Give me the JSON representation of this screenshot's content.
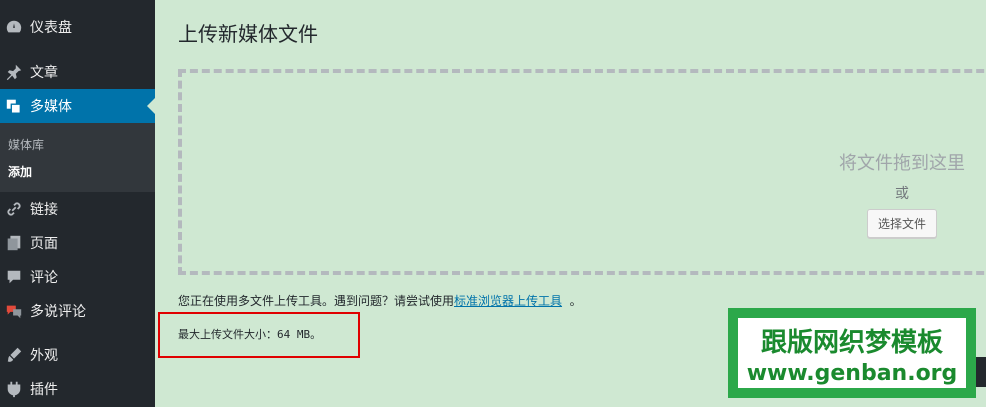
{
  "sidebar": {
    "items": [
      {
        "label": "仪表盘",
        "icon": "dashboard-icon"
      },
      {
        "label": "文章",
        "icon": "pin-icon"
      },
      {
        "label": "多媒体",
        "icon": "media-icon"
      },
      {
        "label": "链接",
        "icon": "link-icon"
      },
      {
        "label": "页面",
        "icon": "page-icon"
      },
      {
        "label": "评论",
        "icon": "comment-icon"
      },
      {
        "label": "多说评论",
        "icon": "duoshuo-icon"
      },
      {
        "label": "外观",
        "icon": "appearance-icon"
      },
      {
        "label": "插件",
        "icon": "plugin-icon"
      }
    ],
    "submenu": [
      {
        "label": "媒体库"
      },
      {
        "label": "添加"
      }
    ]
  },
  "main": {
    "title": "上传新媒体文件",
    "drop_text": "将文件拖到这里",
    "or_text": "或",
    "select_button": "选择文件",
    "info_prefix": "您正在使用多文件上传工具。遇到问题？请尝试使用",
    "info_link": "标准浏览器上传工具",
    "info_suffix": "。",
    "max_size": "最大上传文件大小：64 MB。"
  },
  "watermark": {
    "line1": "跟版网织梦模板",
    "line2": "www.genban.org"
  },
  "colors": {
    "sidebar_bg": "#23282d",
    "active_bg": "#0073aa",
    "content_bg": "#cfe8d2",
    "highlight_border": "#e00000"
  }
}
